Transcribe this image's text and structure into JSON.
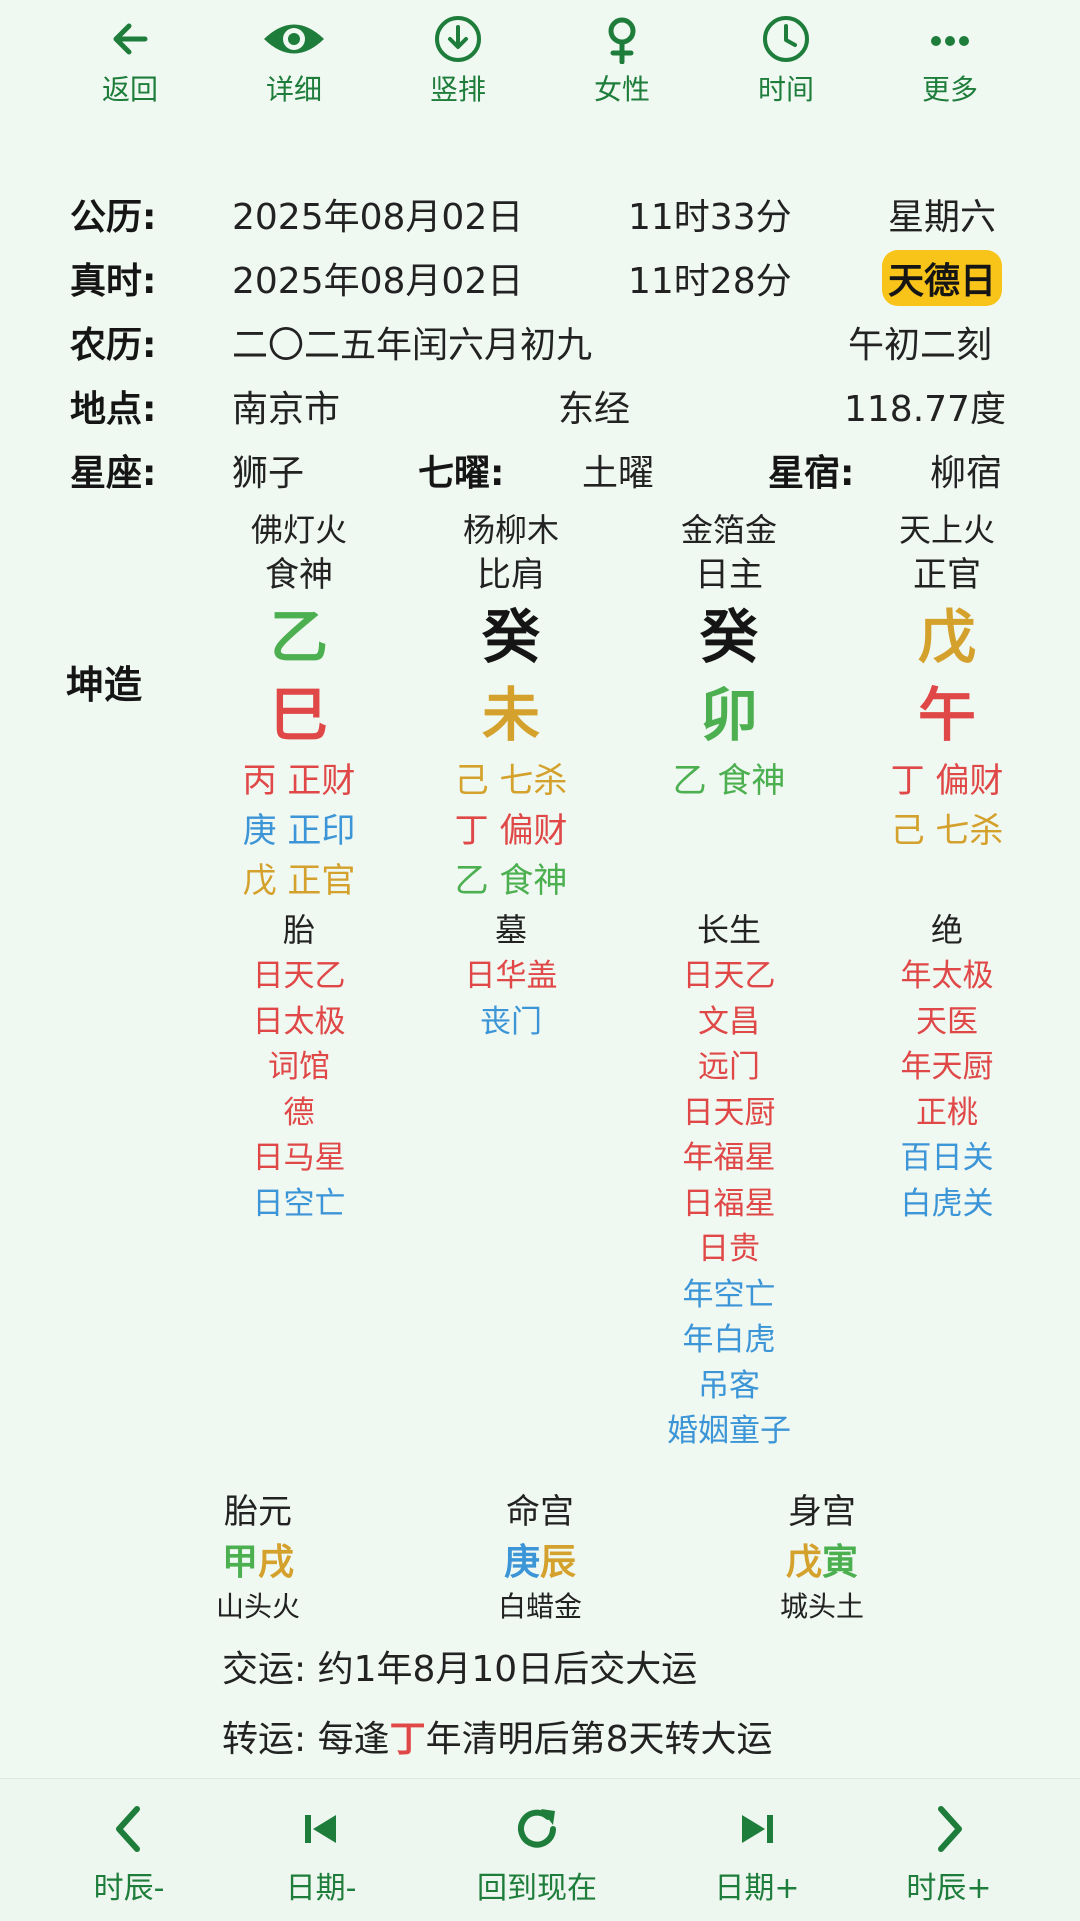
{
  "toolbar": [
    {
      "label": "返回",
      "icon": "arrow-left-icon"
    },
    {
      "label": "详细",
      "icon": "eye-icon"
    },
    {
      "label": "竖排",
      "icon": "download-circle-icon"
    },
    {
      "label": "女性",
      "icon": "female-symbol-icon"
    },
    {
      "label": "时间",
      "icon": "clock-icon"
    },
    {
      "label": "更多",
      "icon": "more-dots-icon"
    }
  ],
  "info": {
    "solar": {
      "label": "公历:",
      "date": "2025年08月02日",
      "time": "11时33分",
      "weekday": "星期六"
    },
    "true_time": {
      "label": "真时:",
      "date": "2025年08月02日",
      "time": "11时28分",
      "badge": "天德日"
    },
    "lunar": {
      "label": "农历:",
      "date": "二〇二五年闰六月初九",
      "ke": "午初二刻"
    },
    "place": {
      "label": "地点:",
      "city": "南京市",
      "lon_label": "东经",
      "lon": "118.77度"
    },
    "star": {
      "label": "星座:",
      "zodiac": "狮子",
      "qiyao_label": "七曜:",
      "qiyao": "土曜",
      "xiu_label": "星宿:",
      "xiu": "柳宿"
    }
  },
  "kunzao": "坤造",
  "pillars": [
    {
      "nayin": "佛灯火",
      "shishen": "食神",
      "gan": "乙",
      "gan_color": "#4caf50",
      "zhi": "巳",
      "zhi_color": "#e04848",
      "hidden": [
        {
          "g": "丙",
          "s": "正财",
          "c": "#e04848"
        },
        {
          "g": "庚",
          "s": "正印",
          "c": "#3b95d6"
        },
        {
          "g": "戊",
          "s": "正官",
          "c": "#d4a12c"
        }
      ],
      "state": "胎",
      "shensha": [
        {
          "t": "日天乙",
          "c": "#e04848"
        },
        {
          "t": "日太极",
          "c": "#e04848"
        },
        {
          "t": "词馆",
          "c": "#e04848"
        },
        {
          "t": "德",
          "c": "#e04848"
        },
        {
          "t": "日马星",
          "c": "#e04848"
        },
        {
          "t": "日空亡",
          "c": "#3b95d6"
        }
      ]
    },
    {
      "nayin": "杨柳木",
      "shishen": "比肩",
      "gan": "癸",
      "gan_color": "#151515",
      "zhi": "未",
      "zhi_color": "#d4a12c",
      "hidden": [
        {
          "g": "己",
          "s": "七杀",
          "c": "#d4a12c"
        },
        {
          "g": "丁",
          "s": "偏财",
          "c": "#e04848"
        },
        {
          "g": "乙",
          "s": "食神",
          "c": "#4caf50"
        }
      ],
      "state": "墓",
      "shensha": [
        {
          "t": "日华盖",
          "c": "#e04848"
        },
        {
          "t": "丧门",
          "c": "#3b95d6"
        }
      ]
    },
    {
      "nayin": "金箔金",
      "shishen": "日主",
      "gan": "癸",
      "gan_color": "#151515",
      "zhi": "卯",
      "zhi_color": "#4caf50",
      "hidden": [
        {
          "g": "乙",
          "s": "食神",
          "c": "#4caf50"
        }
      ],
      "state": "长生",
      "shensha": [
        {
          "t": "日天乙",
          "c": "#e04848"
        },
        {
          "t": "文昌",
          "c": "#e04848"
        },
        {
          "t": "远门",
          "c": "#e04848"
        },
        {
          "t": "日天厨",
          "c": "#e04848"
        },
        {
          "t": "年福星",
          "c": "#e04848"
        },
        {
          "t": "日福星",
          "c": "#e04848"
        },
        {
          "t": "日贵",
          "c": "#e04848"
        },
        {
          "t": "年空亡",
          "c": "#3b95d6"
        },
        {
          "t": "年白虎",
          "c": "#3b95d6"
        },
        {
          "t": "吊客",
          "c": "#3b95d6"
        },
        {
          "t": "婚姻童子",
          "c": "#3b95d6"
        }
      ]
    },
    {
      "nayin": "天上火",
      "shishen": "正官",
      "gan": "戊",
      "gan_color": "#d4a12c",
      "zhi": "午",
      "zhi_color": "#e04848",
      "hidden": [
        {
          "g": "丁",
          "s": "偏财",
          "c": "#e04848"
        },
        {
          "g": "己",
          "s": "七杀",
          "c": "#d4a12c"
        }
      ],
      "state": "绝",
      "shensha": [
        {
          "t": "年太极",
          "c": "#e04848"
        },
        {
          "t": "天医",
          "c": "#e04848"
        },
        {
          "t": "年天厨",
          "c": "#e04848"
        },
        {
          "t": "正桃",
          "c": "#e04848"
        },
        {
          "t": "百日关",
          "c": "#3b95d6"
        },
        {
          "t": "白虎关",
          "c": "#3b95d6"
        }
      ]
    }
  ],
  "extras": [
    {
      "title": "胎元",
      "gan": "甲",
      "gan_color": "#4caf50",
      "zhi": "戌",
      "zhi_color": "#d4a12c",
      "nayin": "山头火"
    },
    {
      "title": "命宫",
      "gan": "庚",
      "gan_color": "#3b95d6",
      "zhi": "辰",
      "zhi_color": "#d4a12c",
      "nayin": "白蜡金"
    },
    {
      "title": "身宫",
      "gan": "戊",
      "gan_color": "#d4a12c",
      "zhi": "寅",
      "zhi_color": "#4caf50",
      "nayin": "城头土"
    }
  ],
  "jiaoyun": {
    "label": "交运:",
    "text": "约1年8月10日后交大运"
  },
  "zhuanyun": {
    "label": "转运:",
    "pre": "每逢",
    "hl": "丁",
    "post": "年清明后第8天转大运",
    "hl_color": "#e04848"
  },
  "bottombar": [
    {
      "label": "时辰-",
      "icon": "chevron-left-icon"
    },
    {
      "label": "日期-",
      "icon": "skip-previous-icon"
    },
    {
      "label": "回到现在",
      "icon": "refresh-icon"
    },
    {
      "label": "日期+",
      "icon": "skip-next-icon"
    },
    {
      "label": "时辰+",
      "icon": "chevron-right-icon"
    }
  ]
}
